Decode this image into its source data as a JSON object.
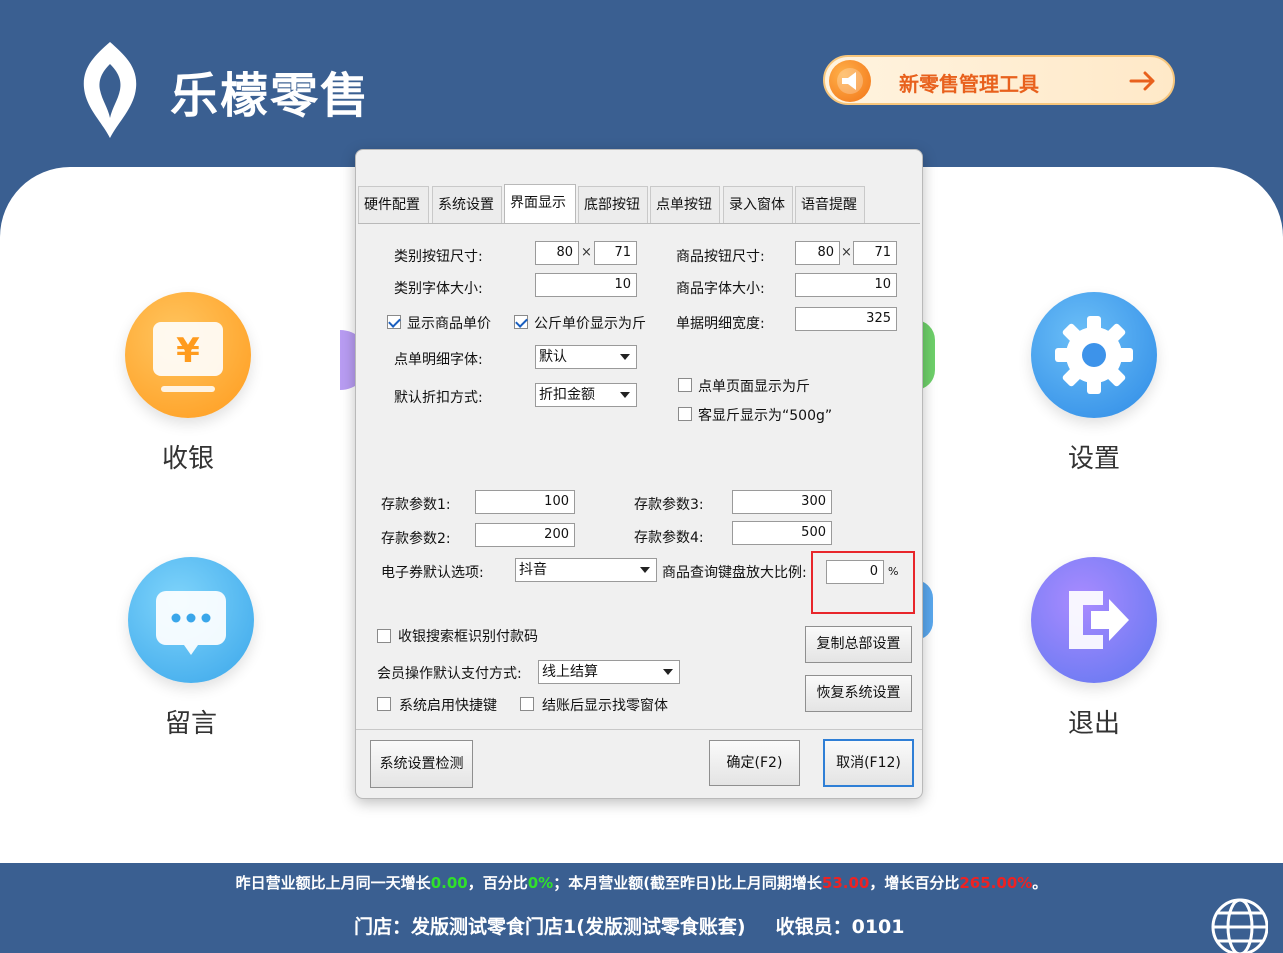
{
  "header": {
    "app_name": "乐檬零售",
    "promo_label": "新零售管理工具"
  },
  "tiles": {
    "cashier": "收银",
    "settings": "设置",
    "messages": "留言",
    "exit": "退出"
  },
  "footer": {
    "summary_a": "昨日营业额比上月同一天增长",
    "val_a": "0.00",
    "summary_b": "，百分比",
    "val_b": "0%",
    "summary_c": "；本月营业额(截至昨日)比上月同期增长",
    "val_c": "53.00",
    "summary_d": "，增长百分比",
    "val_d": "265.00%",
    "summary_e": "。",
    "store": "门店：发版测试零食门店1(发版测试零食账套)",
    "cashier_label": "收银员：0101"
  },
  "dialog": {
    "tabs": [
      "硬件配置",
      "系统设置",
      "界面显示",
      "底部按钮",
      "点单按钮",
      "录入窗体",
      "语音提醒"
    ],
    "active_tab": "界面显示",
    "category_btn_size_label": "类别按钮尺寸:",
    "category_btn_w": "80",
    "category_btn_h": "71",
    "product_btn_size_label": "商品按钮尺寸:",
    "product_btn_w": "80",
    "product_btn_h": "71",
    "size_x": "×",
    "category_font_label": "类别字体大小:",
    "category_font_val": "10",
    "product_font_label": "商品字体大小:",
    "product_font_val": "10",
    "show_unit_price_label": "显示商品单价",
    "show_unit_price_checked": true,
    "kg_price_as_jin_label": "公斤单价显示为斤",
    "kg_price_as_jin_checked": true,
    "detail_width_label": "单据明细宽度:",
    "detail_width_val": "325",
    "detail_font_label": "点单明细字体:",
    "detail_font_val": "默认",
    "discount_mode_label": "默认折扣方式:",
    "discount_mode_val": "折扣金额",
    "order_page_jin_label": "点单页面显示为斤",
    "order_page_jin_checked": false,
    "customer_jin_label": "客显斤显示为“500g”",
    "customer_jin_checked": false,
    "deposit1_label": "存款参数1:",
    "deposit1_val": "100",
    "deposit2_label": "存款参数2:",
    "deposit2_val": "200",
    "deposit3_label": "存款参数3:",
    "deposit3_val": "300",
    "deposit4_label": "存款参数4:",
    "deposit4_val": "500",
    "ecoupon_label": "电子券默认选项:",
    "ecoupon_val": "抖音",
    "keypad_zoom_label": "商品查询键盘放大比例:",
    "keypad_zoom_val": "0",
    "keypad_zoom_unit": "%",
    "search_paycode_label": "收银搜索框识别付款码",
    "search_paycode_checked": false,
    "member_pay_label": "会员操作默认支付方式:",
    "member_pay_val": "线上结算",
    "shortcut_label": "系统启用快捷键",
    "shortcut_checked": false,
    "change_window_label": "结账后显示找零窗体",
    "change_window_checked": false,
    "copy_hq_btn": "复制总部设置",
    "restore_btn": "恢复系统设置",
    "check_btn": "系统设置检测",
    "ok_btn": "确定(F2)",
    "cancel_btn": "取消(F12)"
  },
  "colors": {
    "background": "#3a5f91",
    "accent_orange": "#e8611d",
    "highlight_red": "#e8262b"
  }
}
